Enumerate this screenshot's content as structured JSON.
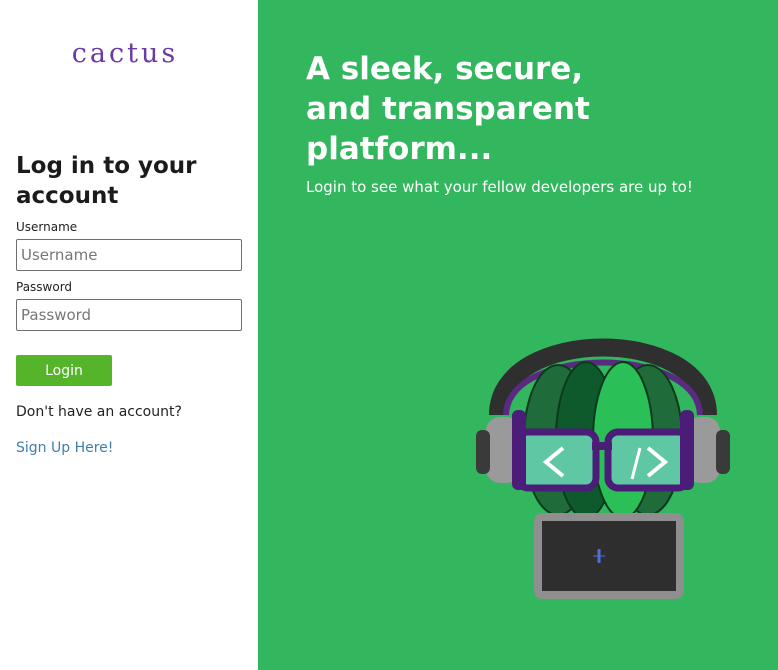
{
  "brand": {
    "logo_text": "cactus"
  },
  "login": {
    "title": "Log in to your account",
    "username_label": "Username",
    "username_placeholder": "Username",
    "password_label": "Password",
    "password_placeholder": "Password",
    "login_button": "Login",
    "no_account_text": "Don't have an account?",
    "signup_link": "Sign Up Here!"
  },
  "hero": {
    "headline_lines": [
      "A sleek, secure,",
      "and transparent",
      "platform..."
    ],
    "tagline": "Login to see what your fellow developers are up to!"
  },
  "colors": {
    "hero_background": "#32b75e",
    "login_button": "#56b42b",
    "logo": "#6a3aa6",
    "link": "#3d7fb0"
  },
  "icons": {
    "mascot": "cactus-with-headphones-and-code-glasses-icon"
  }
}
